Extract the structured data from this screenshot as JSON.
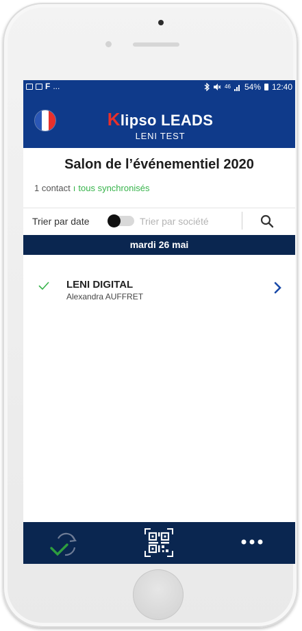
{
  "status_bar": {
    "left_glyph": "F",
    "left_more": "...",
    "network": "46",
    "battery": "54%",
    "time": "12:40"
  },
  "header": {
    "logo_k": "K",
    "logo_rest": "lipso LEADS",
    "subtitle": "LENI TEST",
    "language_flag": "france-flag"
  },
  "event": {
    "title": "Salon de l’événementiel 2020",
    "contact_count": "1 contact",
    "separator": "ı",
    "sync_status": "tous synchronisés"
  },
  "sort": {
    "by_date": "Trier par date",
    "by_company": "Trier par société",
    "toggle_state": "date"
  },
  "list": {
    "date_header": "mardi 26 mai",
    "items": [
      {
        "company": "LENI DIGITAL",
        "contact": "Alexandra AUFFRET",
        "synced": true
      }
    ]
  },
  "bottom_nav": {
    "sync_icon": "sync-check-icon",
    "scan_icon": "qr-code-icon",
    "more_icon": "more-dots-icon"
  },
  "colors": {
    "brand_blue": "#0f3a8a",
    "dark_navy": "#0a2650",
    "accent_red": "#e8302b",
    "success_green": "#36b34a"
  }
}
